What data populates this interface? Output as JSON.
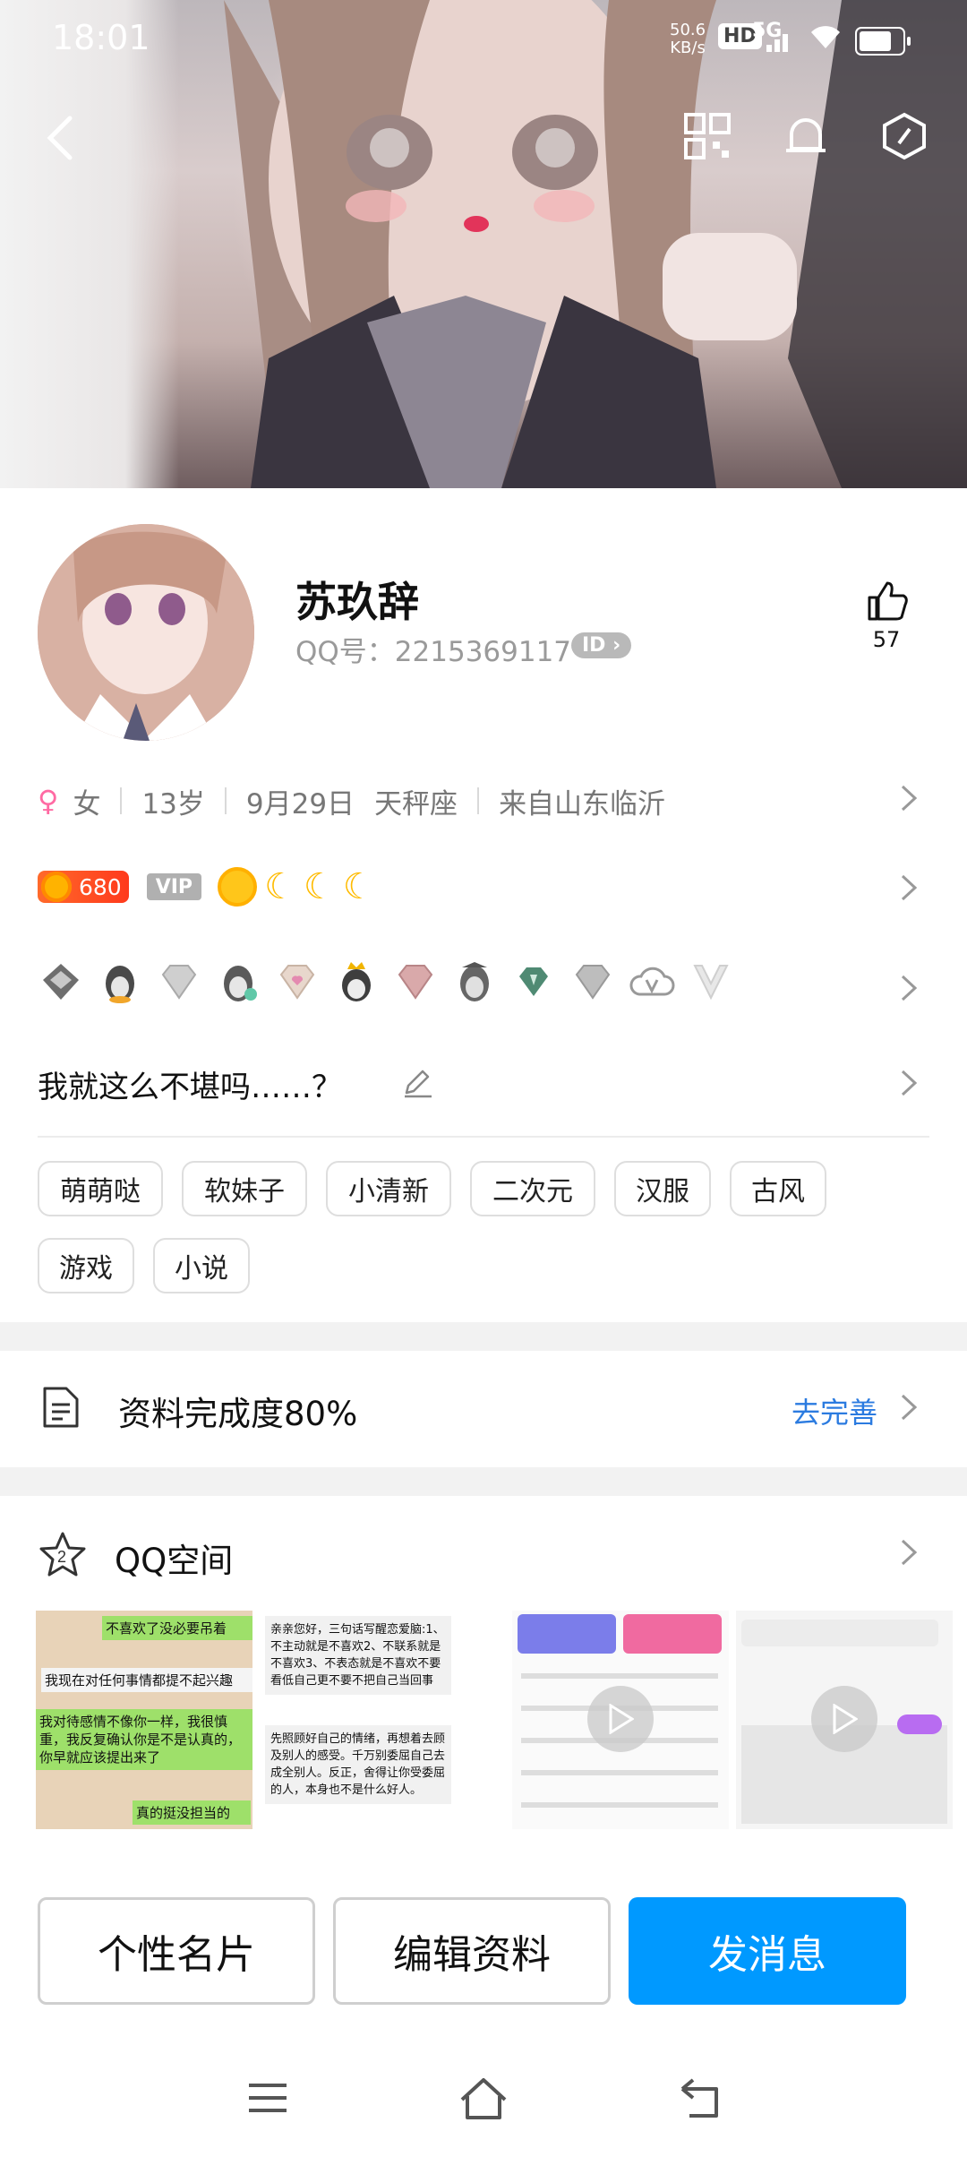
{
  "status_bar": {
    "time": "18:01",
    "net_speed_value": "50.6",
    "net_speed_unit": "KB/s",
    "hd": "HD",
    "network": "5G",
    "battery_level": 0.8
  },
  "header": {
    "back_icon": "back-arrow-icon",
    "qr_icon": "qr-code-icon",
    "bell_icon": "bell-icon",
    "settings_icon": "hexagon-settings-icon"
  },
  "profile": {
    "name": "苏玖辞",
    "qq_label": "QQ号：2215369117",
    "id_badge": "ID",
    "likes": "57",
    "info": {
      "gender": "女",
      "age": "13岁",
      "birthday": "9月29日",
      "zodiac": "天秤座",
      "location": "来自山东临沂"
    },
    "level_value": "680",
    "vip_label": "VIP",
    "signature": "我就这么不堪吗……？",
    "tags": [
      "萌萌哒",
      "软妹子",
      "小清新",
      "二次元",
      "汉服",
      "古风",
      "游戏",
      "小说"
    ]
  },
  "completion": {
    "label": "资料完成度80%",
    "link": "去完善"
  },
  "qzone": {
    "title": "QQ空间",
    "thumb1_lines": [
      "不喜欢了没必要吊着",
      "我现在对任何事情都提不起兴趣",
      "我对待感情不像你一样，我很慎重，我反复确认你是不是认真的，你早就应该提出来了",
      "真的挺没担当的"
    ],
    "thumb2_top": "亲亲您好，三句话写醒恋爱脑:1、不主动就是不喜欢2、不联系就是不喜欢3、不表态就是不喜欢不要看低自己更不要不把自己当回事",
    "thumb2_bottom": "先照顾好自己的情绪，再想着去顾及别人的感受。千万别委屈自己去成全别人。反正，舍得让你受委屈的人，本身也不是什么好人。"
  },
  "actions": {
    "card": "个性名片",
    "edit": "编辑资料",
    "message": "发消息"
  },
  "colors": {
    "accent": "#0099ff",
    "link": "#2b7be0",
    "level_badge": "#ff4a1f"
  }
}
